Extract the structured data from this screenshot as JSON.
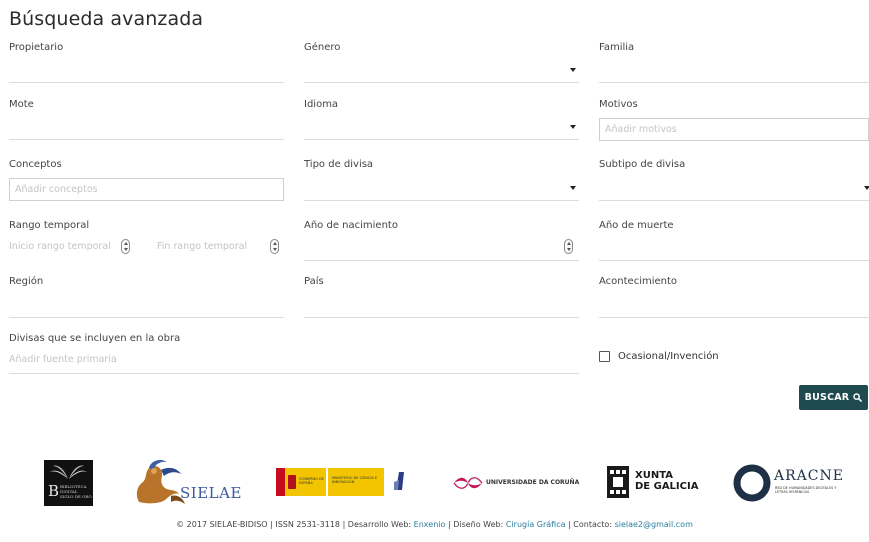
{
  "page": {
    "title": "Búsqueda avanzada"
  },
  "fields": {
    "propietario": {
      "label": "Propietario"
    },
    "genero": {
      "label": "Género"
    },
    "familia": {
      "label": "Familia"
    },
    "mote": {
      "label": "Mote"
    },
    "idioma": {
      "label": "Idioma"
    },
    "motivos": {
      "label": "Motivos",
      "placeholder": "Añadir motivos"
    },
    "conceptos": {
      "label": "Conceptos",
      "placeholder": "Añadir conceptos"
    },
    "tipo_divisa": {
      "label": "Tipo de divisa"
    },
    "subtipo_divisa": {
      "label": "Subtipo de divisa"
    },
    "rango_temporal": {
      "label": "Rango temporal",
      "inicio_placeholder": "Inicio rango temporal",
      "fin_placeholder": "Fin rango temporal"
    },
    "anio_nacimiento": {
      "label": "Año de nacimiento"
    },
    "anio_muerte": {
      "label": "Año de muerte"
    },
    "region": {
      "label": "Región"
    },
    "pais": {
      "label": "País"
    },
    "acontecimiento": {
      "label": "Acontecimiento"
    },
    "divisas_obra": {
      "label": "Divisas que se incluyen en la obra",
      "placeholder": "Añadir fuente primaria"
    },
    "ocasional": {
      "label": "Ocasional/Invención",
      "checked": false
    }
  },
  "search_button": {
    "label": "BUSCAR",
    "icon": "search-icon",
    "color": "#1f4a4f"
  },
  "logos": {
    "biblioteca": {
      "lines": [
        "BIBLIOTECA",
        "DIGITAL",
        "SIGLO DE ORO"
      ],
      "initial": "B"
    },
    "sielae": {
      "text": "SIELAE"
    },
    "gobierno": {
      "text_left": "GOBIERNO DE ESPAÑA",
      "text_right": "MINISTERIO DE CIENCIA E INNOVACIÓN"
    },
    "udc": {
      "text": "UNIVERSIDADE DA CORUÑA"
    },
    "xunta": {
      "line1": "XUNTA",
      "line2": "DE GALICIA"
    },
    "aracne": {
      "title": "ARACNE",
      "subtitle": "RED DE HUMANIDADES DIGITALES Y LETRAS HISPÁNICAS"
    }
  },
  "footer": {
    "copyright": "© 2017 SIELAE-BIDISO | ISSN 2531-3118 | Desarrollo Web: ",
    "dev_link": "Enxenio",
    "design_prefix": " | Diseño Web: ",
    "design_link": "Cirugía Gráfica",
    "contact_prefix": " | Contacto: ",
    "contact_link": "sielae2@gmail.com"
  }
}
